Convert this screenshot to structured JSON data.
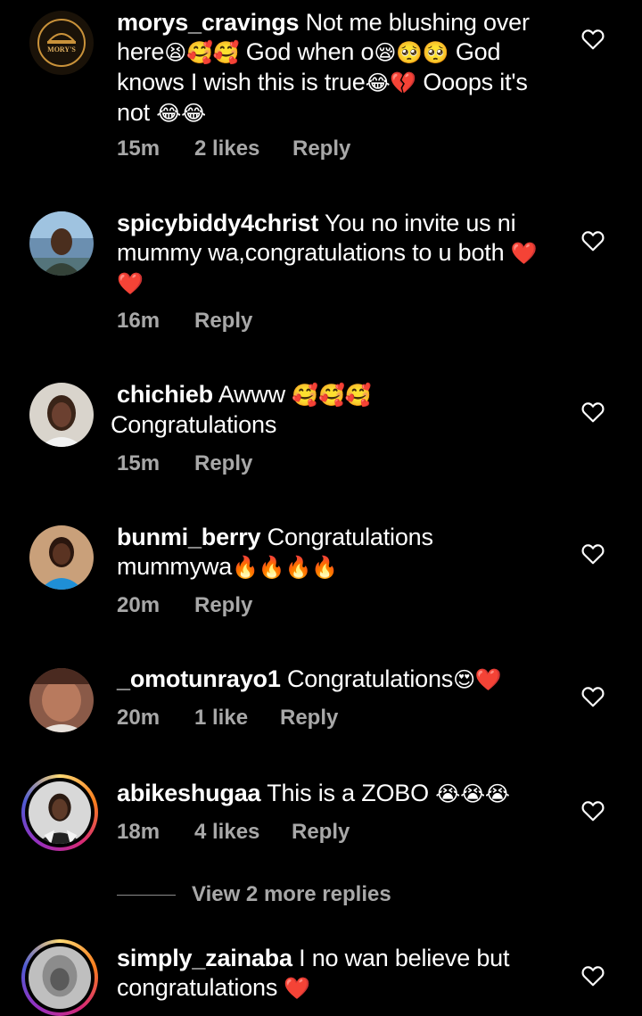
{
  "colors": {
    "background": "#000000",
    "text": "#ffffff",
    "secondary": "#a8a8a8",
    "heart_emoji": "#e0245e"
  },
  "comments": [
    {
      "username": "morys_cravings",
      "text_a": " Not me blushing over here",
      "emoji_a": "😫🥰🥰",
      "text_b": " God when o",
      "emoji_b": "😪🥺🥺",
      "text_c": " God knows I wish this is true",
      "emoji_c": "😂💔",
      "text_d": " Ooops it's not ",
      "emoji_d": "😂😂",
      "time": "15m",
      "likes": "2 likes",
      "reply": "Reply",
      "avatar_text": "MORY'S"
    },
    {
      "username": "spicybiddy4christ",
      "text_a": " You no invite us ni mummy wa,congratulations to u both ",
      "emoji_a": "❤️❤️",
      "time": "16m",
      "reply": "Reply"
    },
    {
      "username": "chichieb",
      "text_a": " Awww ",
      "emoji_a": "🥰🥰🥰",
      "text_b": " Congratulations",
      "time": "15m",
      "reply": "Reply"
    },
    {
      "username": "bunmi_berry",
      "text_a": " Congratulations mummywa",
      "emoji_a": "🔥🔥🔥🔥",
      "time": "20m",
      "reply": "Reply"
    },
    {
      "username": "_omotunrayo1",
      "text_a": " Congratulations",
      "emoji_a": "😍❤️",
      "time": "20m",
      "likes": "1 like",
      "reply": "Reply"
    },
    {
      "username": "abikeshugaa",
      "text_a": " This is a ZOBO ",
      "emoji_a": "😭😭😭",
      "time": "18m",
      "likes": "4 likes",
      "reply": "Reply"
    },
    {
      "username": "simply_zainaba",
      "text_a": " I no wan believe but congratulations ",
      "emoji_a": "❤️"
    }
  ],
  "view_more_replies": "View 2 more replies",
  "icons": {
    "like": "heart-outline-icon"
  }
}
